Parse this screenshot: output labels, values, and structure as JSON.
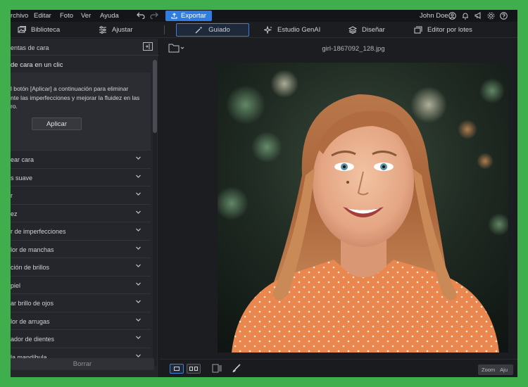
{
  "menu": {
    "items": [
      "rchivo",
      "Editar",
      "Foto",
      "Ver",
      "Ayuda"
    ],
    "export_label": "Exportar",
    "user": "John Doe"
  },
  "tabs": [
    {
      "label": "Biblioteca",
      "icon": "library-icon"
    },
    {
      "label": "Ajustar",
      "icon": "sliders-icon"
    },
    {
      "label": "Guiado",
      "icon": "magic-wand-icon",
      "active": true
    },
    {
      "label": "Estudio GenAI",
      "icon": "sparkle-icon"
    },
    {
      "label": "Diseñar",
      "icon": "layers-icon"
    },
    {
      "label": "Editor por lotes",
      "icon": "batch-icon"
    }
  ],
  "panel": {
    "title": "entas de cara",
    "oneclick_title": "de cara en un clic",
    "oneclick_desc": [
      "l botón [Aplicar] a continuación para eliminar",
      "nte las imperfecciones y mejorar la fluidez en las",
      "ro."
    ],
    "apply_label": "Aplicar",
    "tools": [
      "ear cara",
      "s suave",
      "r",
      "ez",
      "r de imperfecciones",
      "lor de manchas",
      "ción de brillos",
      "piel",
      "ar brillo de ojos",
      "lor de arrugas",
      "ador de dientes",
      " la mandíbula"
    ],
    "reset_label": "Borrar"
  },
  "canvas": {
    "file_name": "girl-1867092_128.jpg",
    "compare_labels": [
      "Zoom",
      "Aju"
    ]
  },
  "colors": {
    "accent": "#2f7de1",
    "frame": "#3fae4d"
  }
}
